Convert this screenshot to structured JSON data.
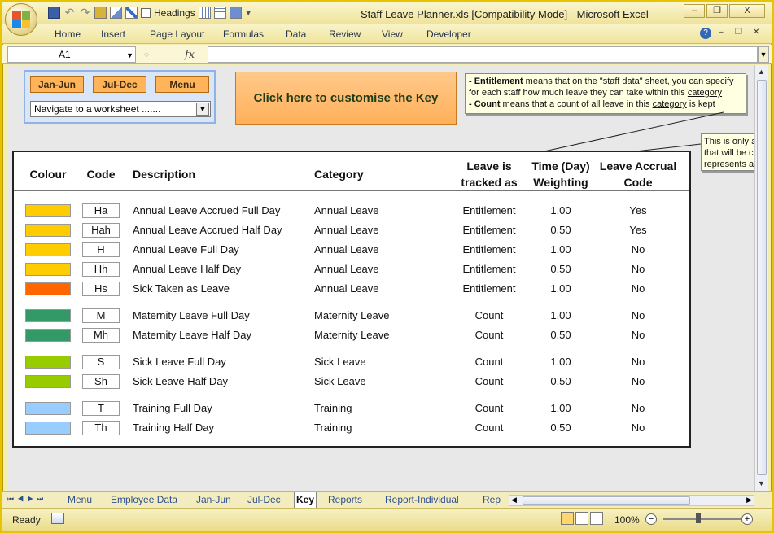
{
  "window": {
    "title": "Staff Leave Planner.xls  [Compatibility Mode] - Microsoft Excel",
    "minimize": "–",
    "restore": "❐",
    "close": "X"
  },
  "qat": {
    "headings_label": "Headings"
  },
  "ribbon": {
    "tabs": [
      "Home",
      "Insert",
      "Page Layout",
      "Formulas",
      "Data",
      "Review",
      "View",
      "Developer"
    ],
    "help": "?"
  },
  "formula_bar": {
    "name_box": "A1",
    "fx": "fx",
    "formula": ""
  },
  "nav_panel": {
    "buttons": [
      "Jan-Jun",
      "Jul-Dec",
      "Menu"
    ],
    "select_value": "Navigate to a worksheet ......."
  },
  "customise_button": "Click here to customise the Key",
  "note_entitlement": {
    "line1_bold": "- Entitlement",
    "line1_rest": " means that on the \"staff data\" sheet, you can specify",
    "line2": "for each staff how much leave they can take within this ",
    "line2_link": "category",
    "line3_bold": "- Count",
    "line3_rest": " means that a count of all leave in this ",
    "line3_link": "category",
    "line3_end": " is kept"
  },
  "note_accrual": {
    "line1": "This is only ap",
    "line2": "that will be ca",
    "line3": "represents a"
  },
  "key_table": {
    "headers": {
      "colour": "Colour",
      "code": "Code",
      "description": "Description",
      "category": "Category",
      "tracked_1": "Leave is",
      "tracked_2": "tracked as",
      "weight_1": "Time (Day)",
      "weight_2": "Weighting",
      "accrual_1": "Leave Accrual",
      "accrual_2": "Code"
    },
    "rows": [
      {
        "color": "#ffcc00",
        "code": "Ha",
        "description": "Annual Leave Accrued Full Day",
        "category": "Annual Leave",
        "tracked": "Entitlement",
        "weighting": "1.00",
        "accrual": "Yes"
      },
      {
        "color": "#ffcc00",
        "code": "Hah",
        "description": "Annual Leave Accrued Half Day",
        "category": "Annual Leave",
        "tracked": "Entitlement",
        "weighting": "0.50",
        "accrual": "Yes"
      },
      {
        "color": "#ffcc00",
        "code": "H",
        "description": "Annual Leave Full Day",
        "category": "Annual Leave",
        "tracked": "Entitlement",
        "weighting": "1.00",
        "accrual": "No"
      },
      {
        "color": "#ffcc00",
        "code": "Hh",
        "description": "Annual Leave Half Day",
        "category": "Annual Leave",
        "tracked": "Entitlement",
        "weighting": "0.50",
        "accrual": "No"
      },
      {
        "color": "#ff6600",
        "code": "Hs",
        "description": "Sick Taken as Leave",
        "category": "Annual Leave",
        "tracked": "Entitlement",
        "weighting": "1.00",
        "accrual": "No"
      },
      {
        "color": "#339966",
        "code": "M",
        "description": "Maternity Leave Full Day",
        "category": "Maternity Leave",
        "tracked": "Count",
        "weighting": "1.00",
        "accrual": "No"
      },
      {
        "color": "#339966",
        "code": "Mh",
        "description": "Maternity Leave Half Day",
        "category": "Maternity Leave",
        "tracked": "Count",
        "weighting": "0.50",
        "accrual": "No"
      },
      {
        "color": "#99cc00",
        "code": "S",
        "description": "Sick Leave Full Day",
        "category": "Sick Leave",
        "tracked": "Count",
        "weighting": "1.00",
        "accrual": "No"
      },
      {
        "color": "#99cc00",
        "code": "Sh",
        "description": "Sick Leave Half Day",
        "category": "Sick Leave",
        "tracked": "Count",
        "weighting": "0.50",
        "accrual": "No"
      },
      {
        "color": "#99ccff",
        "code": "T",
        "description": "Training Full Day",
        "category": "Training",
        "tracked": "Count",
        "weighting": "1.00",
        "accrual": "No"
      },
      {
        "color": "#99ccff",
        "code": "Th",
        "description": "Training Half Day",
        "category": "Training",
        "tracked": "Count",
        "weighting": "0.50",
        "accrual": "No"
      }
    ]
  },
  "sheet_tabs": {
    "tabs": [
      "Menu",
      "Employee Data",
      "Jan-Jun",
      "Jul-Dec",
      "Key",
      "Reports",
      "Report-Individual",
      "Rep"
    ],
    "active": "Key"
  },
  "status_bar": {
    "ready": "Ready",
    "zoom": "100%",
    "zoom_minus": "−",
    "zoom_plus": "+"
  },
  "colors": {
    "accent_orange": "#ffb05a",
    "nav_panel_bg": "#d9e6f7",
    "frame": "#e8c400"
  }
}
